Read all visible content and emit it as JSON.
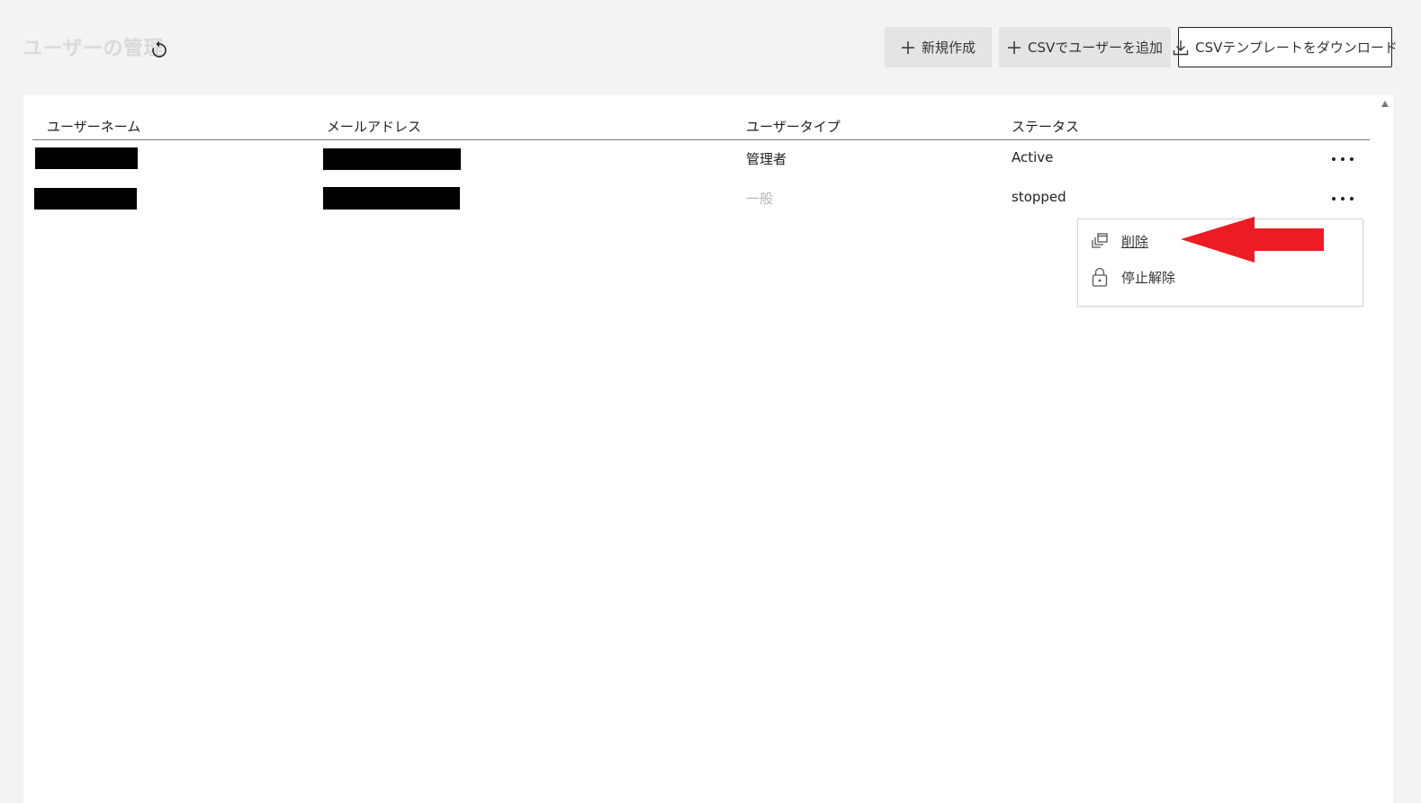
{
  "header": {
    "title": "ユーザーの管理",
    "buttons": {
      "new": "新規作成",
      "csv_add": "CSVでユーザーを追加",
      "csv_template": "CSVテンプレートをダウンロード"
    }
  },
  "table": {
    "columns": [
      "ユーザーネーム",
      "メールアドレス",
      "ユーザータイプ",
      "ステータス"
    ],
    "rows": [
      {
        "type": "管理者",
        "status": "Active"
      },
      {
        "type": "一般",
        "status": "stopped"
      }
    ]
  },
  "menu": {
    "delete": "削除",
    "unsuspend": "停止解除"
  },
  "colors": {
    "annotation_arrow": "#ec1c24",
    "title": "#d9d9d9",
    "muted_text": "#b8b8b8"
  }
}
